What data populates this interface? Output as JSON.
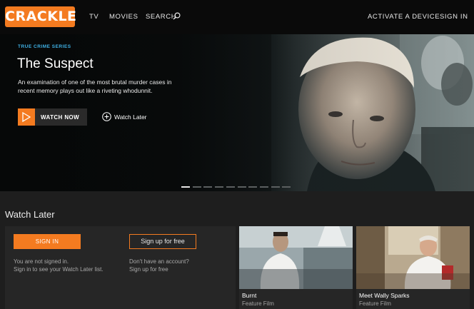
{
  "header": {
    "logo": "CRACKLE",
    "nav": {
      "tv": "TV",
      "movies": "MOVIES",
      "search": "SEARCH",
      "activate": "ACTIVATE A DEVICE",
      "signin": "SIGN IN"
    }
  },
  "hero": {
    "genre": "TRUE CRIME SERIES",
    "title": "The Suspect",
    "description": "An examination of one of the most brutal murder cases in recent memory plays out like a riveting whodunnit.",
    "watch_now": "WATCH NOW",
    "watch_later": "Watch Later",
    "carousel": {
      "slides": 10,
      "active_index": 0
    }
  },
  "watch_later": {
    "heading": "Watch Later",
    "signin_button": "SIGN IN",
    "signup_button": "Sign up for free",
    "not_signed_in": "You are not signed in.",
    "signin_hint": "Sign in to see your Watch Later list.",
    "no_account": "Don't have an account?",
    "signup_hint": "Sign up for free"
  },
  "cards": [
    {
      "title": "Burnt",
      "subtitle": "Feature Film"
    },
    {
      "title": "Meet Wally Sparks",
      "subtitle": "Feature Film"
    }
  ],
  "colors": {
    "accent": "#f47b20",
    "genre": "#3fb2e6",
    "background": "#1e1e1e",
    "header": "#0a0a0a"
  },
  "icons": {
    "search": "search-icon",
    "play": "play-icon",
    "add": "plus-circle-icon"
  }
}
